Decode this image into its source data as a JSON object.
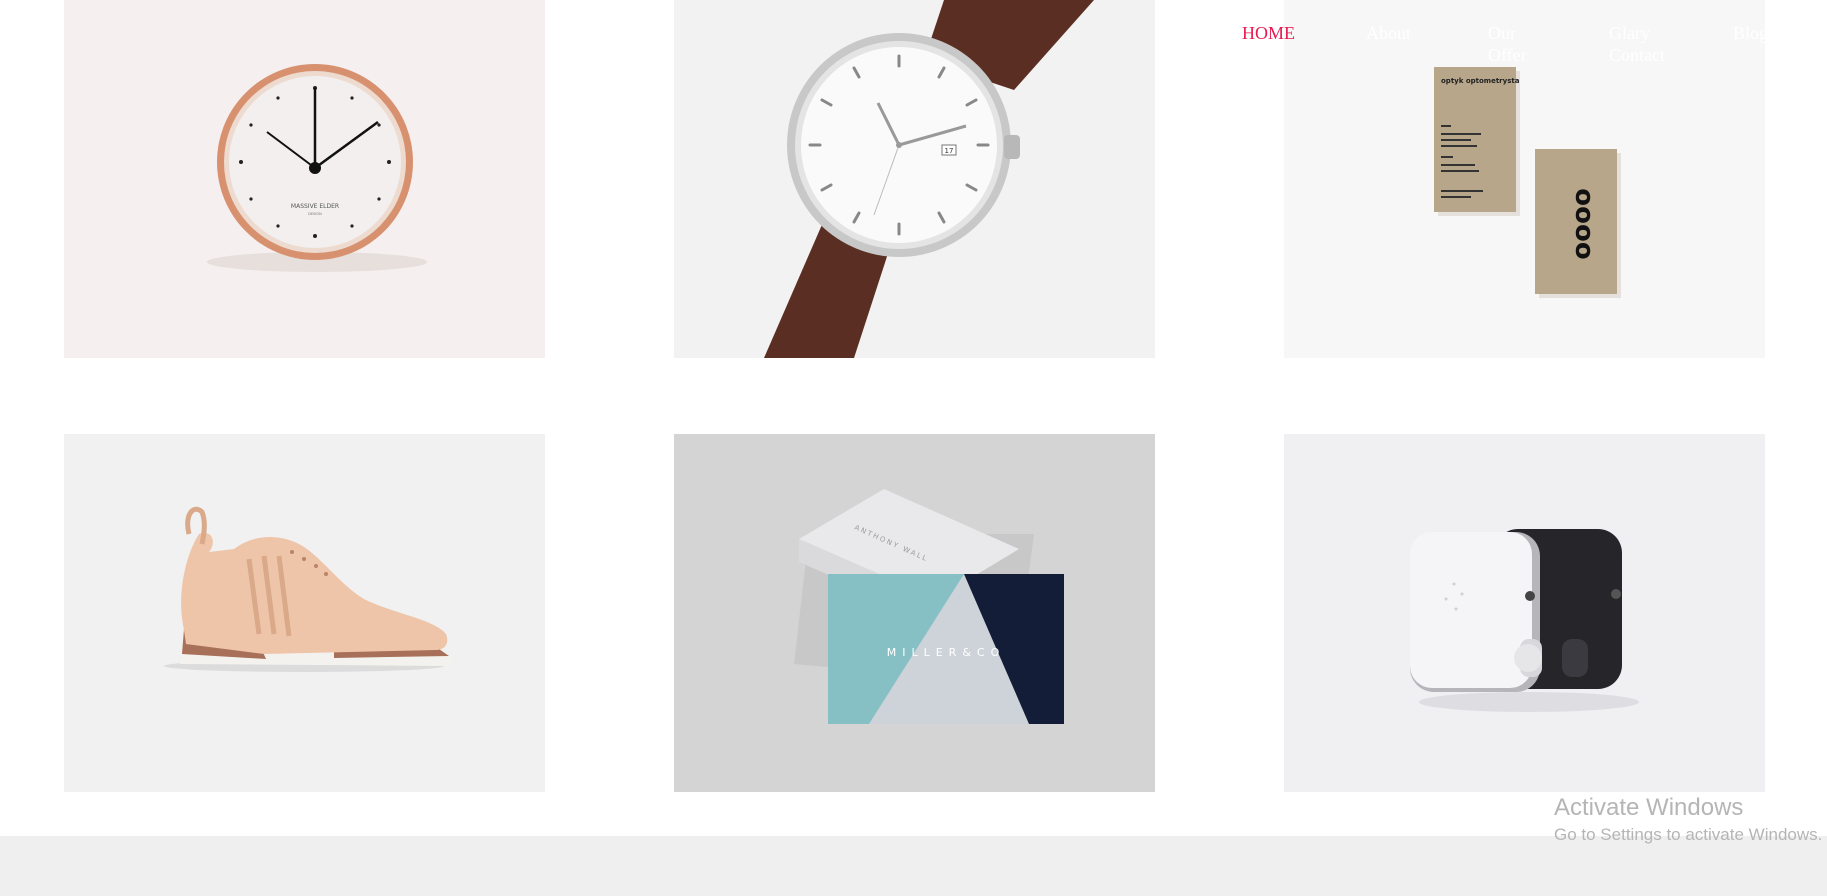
{
  "nav": {
    "items": [
      {
        "label": "HOME"
      },
      {
        "label": "About"
      },
      {
        "label": "Our Offer"
      },
      {
        "label": "Glary Contact"
      },
      {
        "label": "Blog"
      }
    ],
    "active_color": "#e8194f",
    "text_color": "#ffffff"
  },
  "gallery": {
    "items": [
      {
        "subject": "copper wall clock",
        "clock_brand": "MASSIVE ELDER",
        "clock_sub": "DESIGN"
      },
      {
        "subject": "wristwatch with brown leather strap",
        "date_label": "17"
      },
      {
        "subject": "kraft business cards",
        "card_title": "optyk optometrysta",
        "card_logo": "oooo"
      },
      {
        "subject": "peach sneaker"
      },
      {
        "subject": "business cards",
        "card_brand": "MILLER&CO",
        "card_name": "ANTHONY WALL"
      },
      {
        "subject": "audio devices"
      }
    ]
  },
  "watermark": {
    "title": "Activate Windows",
    "subtitle": "Go to Settings to activate Windows."
  }
}
